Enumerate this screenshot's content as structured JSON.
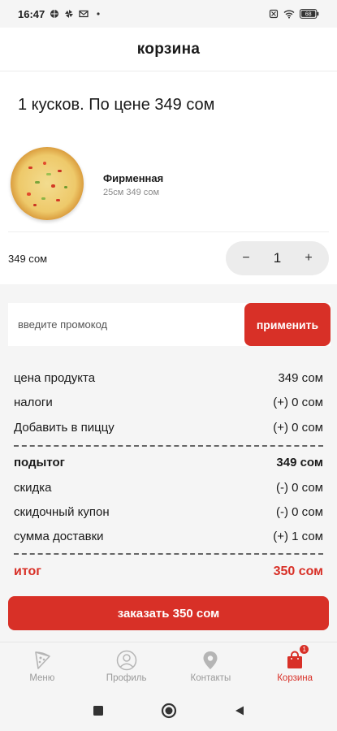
{
  "status_bar": {
    "time": "16:47",
    "left_icons": [
      "globe-icon",
      "pinwheel-icon",
      "mail-icon",
      "dot-icon"
    ],
    "right_icons": [
      "sim-off-icon",
      "wifi-icon",
      "battery-icon"
    ],
    "battery": "68"
  },
  "header": {
    "title": "корзина"
  },
  "cart": {
    "headline": "1 кусков. По цене 349 сом",
    "item": {
      "name": "Фирменная",
      "details": "25см 349 сом",
      "price": "349 сом",
      "quantity": "1",
      "minus": "−",
      "plus": "+"
    }
  },
  "promo": {
    "placeholder": "введите промокод",
    "value": "",
    "apply_label": "применить"
  },
  "totals": {
    "rows": [
      {
        "label": "цена продукта",
        "value": "349 сом"
      },
      {
        "label": "налоги",
        "value": "(+) 0 сом"
      },
      {
        "label": "Добавить в пиццу",
        "value": "(+) 0 сом"
      }
    ],
    "subtotal": {
      "label": "подытог",
      "value": "349 сом"
    },
    "adjustments": [
      {
        "label": "скидка",
        "value": "(-) 0 сом"
      },
      {
        "label": "скидочный купон",
        "value": "(-) 0 сом"
      },
      {
        "label": "сумма доставки",
        "value": "(+) 1 сом"
      }
    ],
    "total": {
      "label": "итог",
      "value": "350 сом"
    }
  },
  "order_button": {
    "label": "заказать 350 сом"
  },
  "tabs": [
    {
      "label": "Меню",
      "icon": "pizza-slice-icon",
      "active": false
    },
    {
      "label": "Профиль",
      "icon": "user-icon",
      "active": false
    },
    {
      "label": "Контакты",
      "icon": "location-pin-icon",
      "active": false
    },
    {
      "label": "Корзина",
      "icon": "shopping-bag-icon",
      "active": true,
      "badge": "1"
    }
  ],
  "system_nav": {
    "icons": [
      "recents-square-icon",
      "home-circle-icon",
      "back-triangle-icon"
    ]
  },
  "colors": {
    "accent": "#d83027",
    "background": "#f5f5f5",
    "card": "#ffffff",
    "muted": "#9a9a9a"
  }
}
